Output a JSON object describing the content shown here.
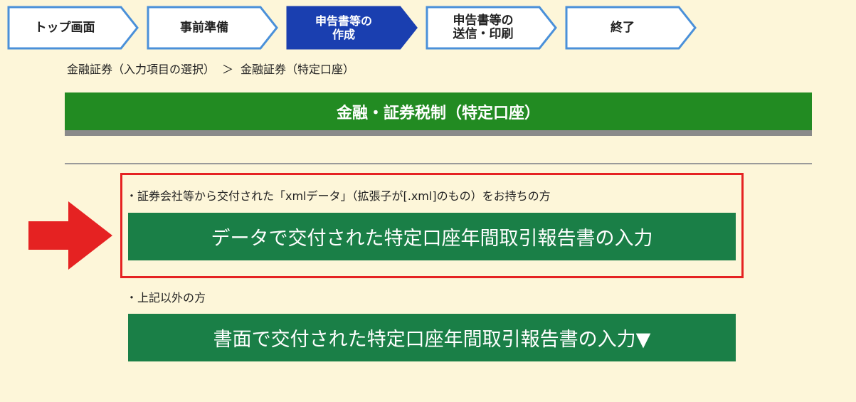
{
  "steps": [
    {
      "label": "トップ画面",
      "active": false
    },
    {
      "label": "事前準備",
      "active": false
    },
    {
      "label": "申告書等の\n作成",
      "active": true
    },
    {
      "label": "申告書等の\n送信・印刷",
      "active": false
    },
    {
      "label": "終了",
      "active": false
    }
  ],
  "breadcrumb": {
    "parent": "金融証券（入力項目の選択）",
    "separator": "＞",
    "current": "金融証券（特定口座）"
  },
  "page_title": "金融・証券税制（特定口座）",
  "xml_section": {
    "note": "・証券会社等から交付された「xmlデータ」（拡張子が[.xml]のもの）をお持ちの方",
    "button_label": "データで交付された特定口座年間取引報告書の入力"
  },
  "other_section": {
    "note": "・上記以外の方",
    "button_label": "書面で交付された特定口座年間取引報告書の入力▼"
  },
  "colors": {
    "background": "#fdf6d9",
    "title_green": "#228b22",
    "button_green": "#1a7f47",
    "highlight_red": "#e52222",
    "active_step": "#1a3fb0",
    "step_border": "#4a90d9"
  },
  "icons": {
    "pointer_arrow": "right-arrow-icon"
  }
}
